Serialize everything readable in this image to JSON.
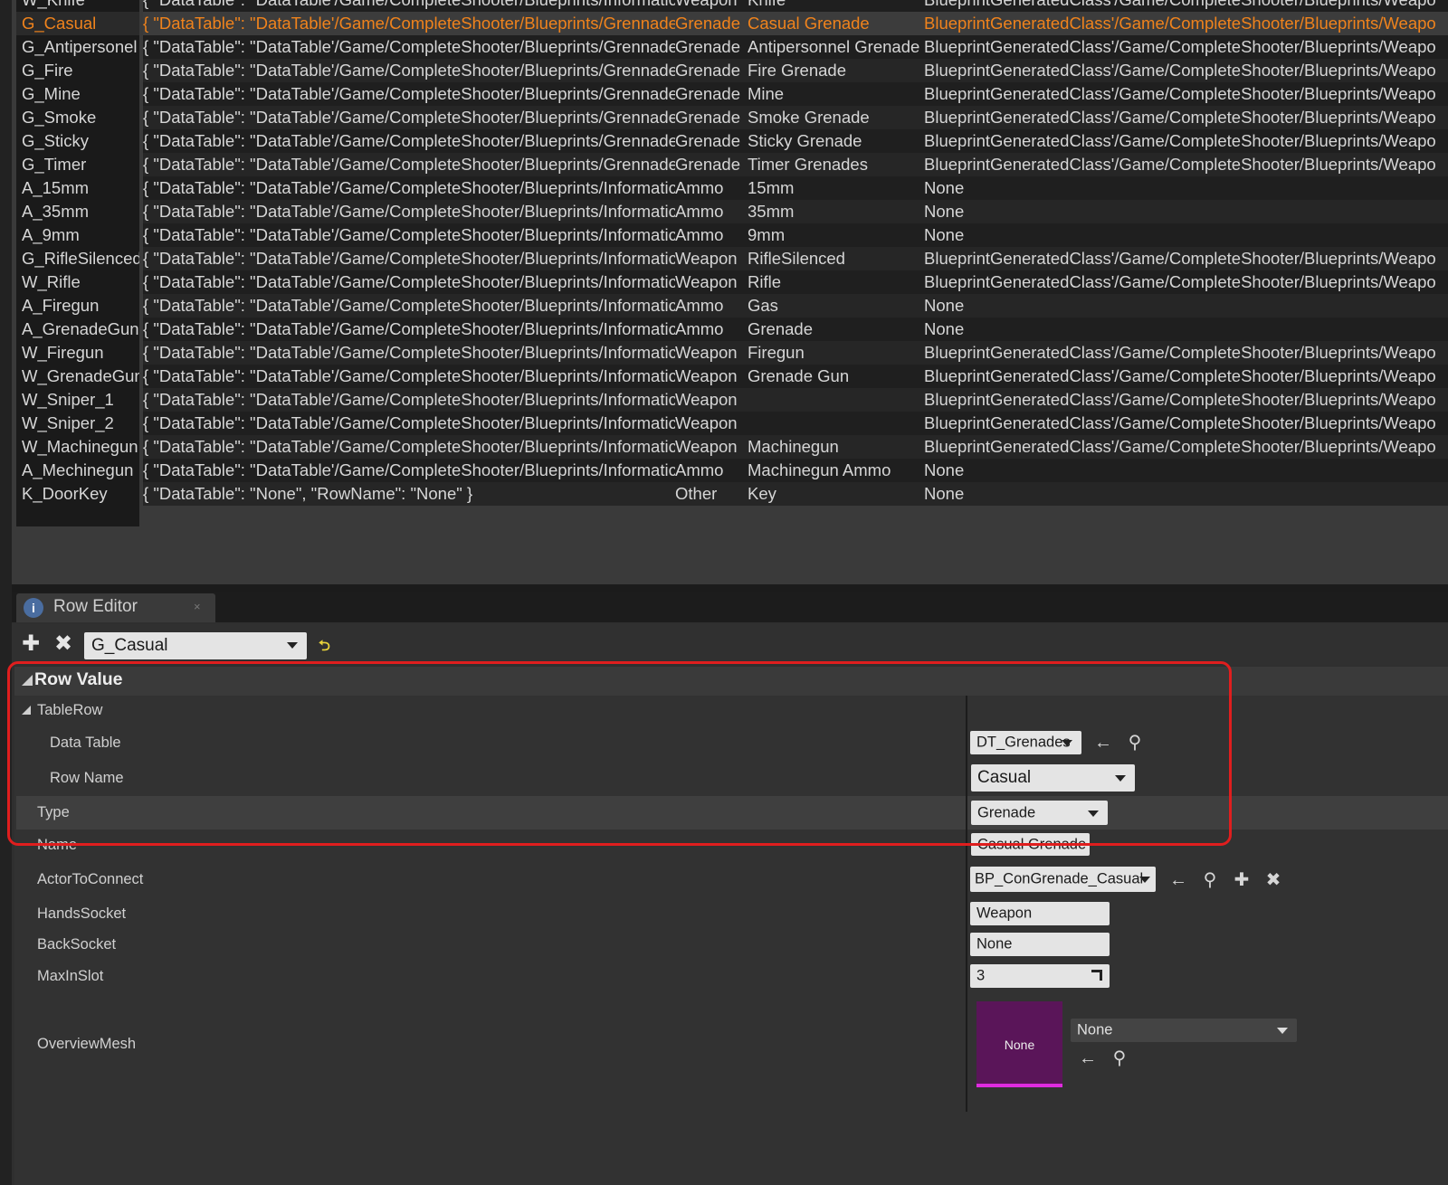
{
  "table": {
    "partial_top_row": {
      "name": "W_Knife",
      "json": "{ \"DataTable\": \"DataTable'/Game/CompleteShooter/Blueprints/Informatic",
      "type": "Weapon",
      "display_name": "Knife",
      "actor": "BlueprintGeneratedClass'/Game/CompleteShooter/Blueprints/Weapo"
    },
    "rows": [
      {
        "name": "G_Casual",
        "json": "{ \"DataTable\": \"DataTable'/Game/CompleteShooter/Blueprints/Grennade,",
        "type": "Grenade",
        "display_name": "Casual Grenade",
        "actor": "BlueprintGeneratedClass'/Game/CompleteShooter/Blueprints/Weapo",
        "selected": true
      },
      {
        "name": "G_Antipersonel",
        "json": "{ \"DataTable\": \"DataTable'/Game/CompleteShooter/Blueprints/Grennade,",
        "type": "Grenade",
        "display_name": "Antipersonnel Grenade",
        "actor": "BlueprintGeneratedClass'/Game/CompleteShooter/Blueprints/Weapo"
      },
      {
        "name": "G_Fire",
        "json": "{ \"DataTable\": \"DataTable'/Game/CompleteShooter/Blueprints/Grennade,",
        "type": "Grenade",
        "display_name": "Fire Grenade",
        "actor": "BlueprintGeneratedClass'/Game/CompleteShooter/Blueprints/Weapo"
      },
      {
        "name": "G_Mine",
        "json": "{ \"DataTable\": \"DataTable'/Game/CompleteShooter/Blueprints/Grennade,",
        "type": "Grenade",
        "display_name": "Mine",
        "actor": "BlueprintGeneratedClass'/Game/CompleteShooter/Blueprints/Weapo"
      },
      {
        "name": "G_Smoke",
        "json": "{ \"DataTable\": \"DataTable'/Game/CompleteShooter/Blueprints/Grennade,",
        "type": "Grenade",
        "display_name": "Smoke Grenade",
        "actor": "BlueprintGeneratedClass'/Game/CompleteShooter/Blueprints/Weapo"
      },
      {
        "name": "G_Sticky",
        "json": "{ \"DataTable\": \"DataTable'/Game/CompleteShooter/Blueprints/Grennade,",
        "type": "Grenade",
        "display_name": "Sticky Grenade",
        "actor": "BlueprintGeneratedClass'/Game/CompleteShooter/Blueprints/Weapo"
      },
      {
        "name": "G_Timer",
        "json": "{ \"DataTable\": \"DataTable'/Game/CompleteShooter/Blueprints/Grennade,",
        "type": "Grenade",
        "display_name": "Timer Grenades",
        "actor": "BlueprintGeneratedClass'/Game/CompleteShooter/Blueprints/Weapo"
      },
      {
        "name": "A_15mm",
        "json": "{ \"DataTable\": \"DataTable'/Game/CompleteShooter/Blueprints/Informatic",
        "type": "Ammo",
        "display_name": "15mm",
        "actor": "None"
      },
      {
        "name": "A_35mm",
        "json": "{ \"DataTable\": \"DataTable'/Game/CompleteShooter/Blueprints/Informatic",
        "type": "Ammo",
        "display_name": "35mm",
        "actor": "None"
      },
      {
        "name": "A_9mm",
        "json": "{ \"DataTable\": \"DataTable'/Game/CompleteShooter/Blueprints/Informatic",
        "type": "Ammo",
        "display_name": "9mm",
        "actor": "None"
      },
      {
        "name": "G_RifleSilenced",
        "json": "{ \"DataTable\": \"DataTable'/Game/CompleteShooter/Blueprints/Informatic",
        "type": "Weapon",
        "display_name": "RifleSilenced",
        "actor": "BlueprintGeneratedClass'/Game/CompleteShooter/Blueprints/Weapo"
      },
      {
        "name": "W_Rifle",
        "json": "{ \"DataTable\": \"DataTable'/Game/CompleteShooter/Blueprints/Informatic",
        "type": "Weapon",
        "display_name": "Rifle",
        "actor": "BlueprintGeneratedClass'/Game/CompleteShooter/Blueprints/Weapo"
      },
      {
        "name": "A_Firegun",
        "json": "{ \"DataTable\": \"DataTable'/Game/CompleteShooter/Blueprints/Informatic",
        "type": "Ammo",
        "display_name": "Gas",
        "actor": "None"
      },
      {
        "name": "A_GrenadeGun",
        "json": "{ \"DataTable\": \"DataTable'/Game/CompleteShooter/Blueprints/Informatic",
        "type": "Ammo",
        "display_name": "Grenade",
        "actor": "None"
      },
      {
        "name": "W_Firegun",
        "json": "{ \"DataTable\": \"DataTable'/Game/CompleteShooter/Blueprints/Informatic",
        "type": "Weapon",
        "display_name": "Firegun",
        "actor": "BlueprintGeneratedClass'/Game/CompleteShooter/Blueprints/Weapo"
      },
      {
        "name": "W_GrenadeGun",
        "json": "{ \"DataTable\": \"DataTable'/Game/CompleteShooter/Blueprints/Informatic",
        "type": "Weapon",
        "display_name": "Grenade Gun",
        "actor": "BlueprintGeneratedClass'/Game/CompleteShooter/Blueprints/Weapo"
      },
      {
        "name": "W_Sniper_1",
        "json": "{ \"DataTable\": \"DataTable'/Game/CompleteShooter/Blueprints/Informatic",
        "type": "Weapon",
        "display_name": "",
        "actor": "BlueprintGeneratedClass'/Game/CompleteShooter/Blueprints/Weapo"
      },
      {
        "name": "W_Sniper_2",
        "json": "{ \"DataTable\": \"DataTable'/Game/CompleteShooter/Blueprints/Informatic",
        "type": "Weapon",
        "display_name": "",
        "actor": "BlueprintGeneratedClass'/Game/CompleteShooter/Blueprints/Weapo"
      },
      {
        "name": "W_Machinegun",
        "json": "{ \"DataTable\": \"DataTable'/Game/CompleteShooter/Blueprints/Informatic",
        "type": "Weapon",
        "display_name": "Machinegun",
        "actor": "BlueprintGeneratedClass'/Game/CompleteShooter/Blueprints/Weapo"
      },
      {
        "name": "A_Mechinegun",
        "json": "{ \"DataTable\": \"DataTable'/Game/CompleteShooter/Blueprints/Informatic",
        "type": "Ammo",
        "display_name": "Machinegun Ammo",
        "actor": "None"
      },
      {
        "name": "K_DoorKey",
        "json": "{ \"DataTable\": \"None\", \"RowName\": \"None\" }",
        "type": "Other",
        "display_name": "Key",
        "actor": "None"
      }
    ]
  },
  "tab": {
    "label": "Row Editor",
    "icon": "info-icon",
    "icon_glyph": "i",
    "close": "×"
  },
  "toolbar": {
    "add_glyph": "✚",
    "remove_glyph": "✖",
    "row_selected": "G_Casual",
    "reset_glyph": "⮌"
  },
  "row_value": {
    "header": "Row Value",
    "table_row_label": "TableRow",
    "data_table_label": "Data Table",
    "data_table_value": "DT_Grenades",
    "row_name_label": "Row Name",
    "row_name_value": "Casual",
    "type_label": "Type",
    "type_value": "Grenade",
    "name_label": "Name",
    "name_value": "Casual Grenade",
    "actor_label": "ActorToConnect",
    "actor_value": "BP_ConGrenade_Casual",
    "hands_label": "HandsSocket",
    "hands_value": "Weapon",
    "back_label": "BackSocket",
    "back_value": "None",
    "max_label": "MaxInSlot",
    "max_value": "3",
    "mesh_label": "OverviewMesh",
    "mesh_thumb_text": "None",
    "mesh_value": "None"
  },
  "colors": {
    "selected_text": "#f0831c",
    "highlight_border": "#e01e1e",
    "mesh_thumb": "#5a1559"
  },
  "icons": {
    "back_arrow": "←",
    "search": "⚲",
    "plus": "✚",
    "clear": "✖"
  }
}
